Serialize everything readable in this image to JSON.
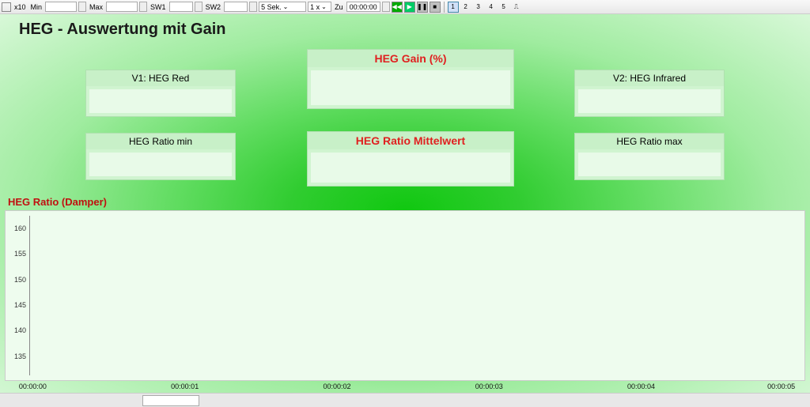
{
  "toolbar": {
    "x10_label": "x10",
    "min_label": "Min",
    "max_label": "Max",
    "sw1_label": "SW1",
    "sw2_label": "SW2",
    "duration_value": "5 Sek.",
    "speed_value": "1 x",
    "zu_label": "Zu",
    "time_value": "00:00:00",
    "page_numbers": [
      "1",
      "2",
      "3",
      "4",
      "5"
    ]
  },
  "page_title": "HEG - Auswertung mit Gain",
  "panels": {
    "gain": {
      "title": "HEG Gain (%)"
    },
    "v1": {
      "title": "V1: HEG Red"
    },
    "v2": {
      "title": "V2: HEG Infrared"
    },
    "ratio_min": {
      "title": "HEG Ratio min"
    },
    "ratio_mittel": {
      "title": "HEG Ratio Mittelwert"
    },
    "ratio_max": {
      "title": "HEG Ratio max"
    }
  },
  "chart_title": "HEG Ratio (Damper)",
  "chart_data": {
    "type": "line",
    "title": "HEG Ratio (Damper)",
    "xlabel": "",
    "ylabel": "",
    "x_ticks": [
      "00:00:00",
      "00:00:01",
      "00:00:02",
      "00:00:03",
      "00:00:04",
      "00:00:05"
    ],
    "y_ticks": [
      135,
      140,
      145,
      150,
      155,
      160
    ],
    "ylim": [
      135,
      162
    ],
    "xlim": [
      "00:00:00",
      "00:00:05"
    ],
    "series": [
      {
        "name": "HEG Ratio (Damper)",
        "x": [],
        "values": []
      }
    ]
  }
}
